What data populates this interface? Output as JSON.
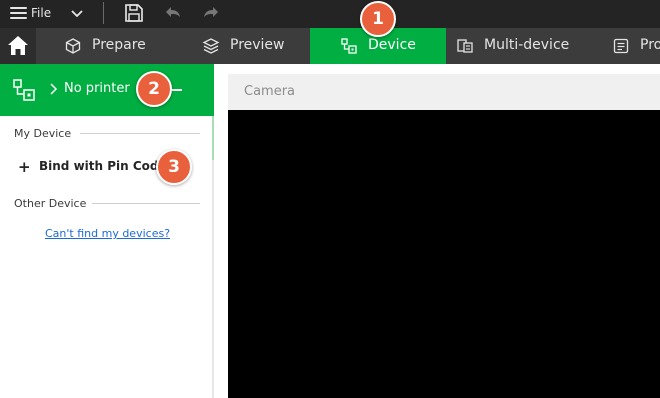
{
  "titlebar": {
    "file_label": "File",
    "menu_icon": "hamburger-menu-icon",
    "dropdown_icon": "chevron-down-icon",
    "save_icon": "save-icon",
    "undo_icon": "undo-icon",
    "redo_icon": "redo-icon"
  },
  "tabs": [
    {
      "label": "Prepare",
      "icon": "cube-icon"
    },
    {
      "label": "Preview",
      "icon": "layers-icon"
    },
    {
      "label": "Device",
      "icon": "device-icon",
      "active": true
    },
    {
      "label": "Multi-device",
      "icon": "multi-device-icon"
    },
    {
      "label": "Pro",
      "icon": "project-icon"
    }
  ],
  "printer_bar": {
    "label": "No printer",
    "icon": "printer-device-icon"
  },
  "device_panel": {
    "my_device_heading": "My Device",
    "bind_label": "Bind with Pin Cod",
    "other_device_heading": "Other Device",
    "cant_find_link": "Can't find my devices?"
  },
  "camera": {
    "label": "Camera"
  },
  "badges": [
    "1",
    "2",
    "3"
  ],
  "colors": {
    "accent_green": "#00ae42",
    "titlebar_bg": "#242424",
    "tabbar_bg": "#3c3c3c",
    "badge_orange": "#e8613c",
    "link_blue": "#1c6ad8"
  }
}
